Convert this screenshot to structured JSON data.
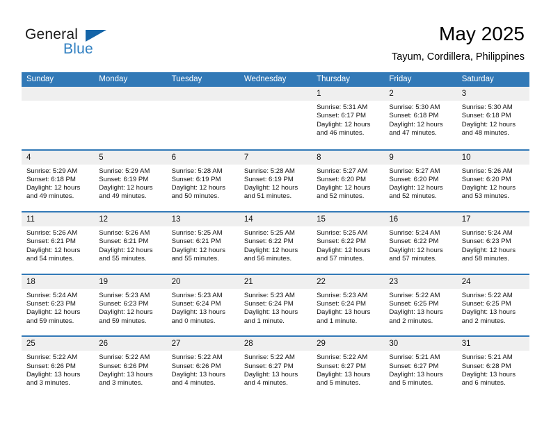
{
  "brand": {
    "name_part1": "General",
    "name_part2": "Blue",
    "flag_icon": "blue-triangle-flag-icon",
    "accent_color": "#2f7fc1"
  },
  "header": {
    "title": "May 2025",
    "location": "Tayum, Cordillera, Philippines"
  },
  "theme": {
    "header_blue": "#3279b7",
    "day_band_gray": "#efefef",
    "text_color": "#111111"
  },
  "weekdays": [
    "Sunday",
    "Monday",
    "Tuesday",
    "Wednesday",
    "Thursday",
    "Friday",
    "Saturday"
  ],
  "weeks": [
    [
      {
        "day": "",
        "lines": [
          "",
          "",
          "",
          ""
        ]
      },
      {
        "day": "",
        "lines": [
          "",
          "",
          "",
          ""
        ]
      },
      {
        "day": "",
        "lines": [
          "",
          "",
          "",
          ""
        ]
      },
      {
        "day": "",
        "lines": [
          "",
          "",
          "",
          ""
        ]
      },
      {
        "day": "1",
        "lines": [
          "Sunrise: 5:31 AM",
          "Sunset: 6:17 PM",
          "Daylight: 12 hours",
          "and 46 minutes."
        ]
      },
      {
        "day": "2",
        "lines": [
          "Sunrise: 5:30 AM",
          "Sunset: 6:18 PM",
          "Daylight: 12 hours",
          "and 47 minutes."
        ]
      },
      {
        "day": "3",
        "lines": [
          "Sunrise: 5:30 AM",
          "Sunset: 6:18 PM",
          "Daylight: 12 hours",
          "and 48 minutes."
        ]
      }
    ],
    [
      {
        "day": "4",
        "lines": [
          "Sunrise: 5:29 AM",
          "Sunset: 6:18 PM",
          "Daylight: 12 hours",
          "and 49 minutes."
        ]
      },
      {
        "day": "5",
        "lines": [
          "Sunrise: 5:29 AM",
          "Sunset: 6:19 PM",
          "Daylight: 12 hours",
          "and 49 minutes."
        ]
      },
      {
        "day": "6",
        "lines": [
          "Sunrise: 5:28 AM",
          "Sunset: 6:19 PM",
          "Daylight: 12 hours",
          "and 50 minutes."
        ]
      },
      {
        "day": "7",
        "lines": [
          "Sunrise: 5:28 AM",
          "Sunset: 6:19 PM",
          "Daylight: 12 hours",
          "and 51 minutes."
        ]
      },
      {
        "day": "8",
        "lines": [
          "Sunrise: 5:27 AM",
          "Sunset: 6:20 PM",
          "Daylight: 12 hours",
          "and 52 minutes."
        ]
      },
      {
        "day": "9",
        "lines": [
          "Sunrise: 5:27 AM",
          "Sunset: 6:20 PM",
          "Daylight: 12 hours",
          "and 52 minutes."
        ]
      },
      {
        "day": "10",
        "lines": [
          "Sunrise: 5:26 AM",
          "Sunset: 6:20 PM",
          "Daylight: 12 hours",
          "and 53 minutes."
        ]
      }
    ],
    [
      {
        "day": "11",
        "lines": [
          "Sunrise: 5:26 AM",
          "Sunset: 6:21 PM",
          "Daylight: 12 hours",
          "and 54 minutes."
        ]
      },
      {
        "day": "12",
        "lines": [
          "Sunrise: 5:26 AM",
          "Sunset: 6:21 PM",
          "Daylight: 12 hours",
          "and 55 minutes."
        ]
      },
      {
        "day": "13",
        "lines": [
          "Sunrise: 5:25 AM",
          "Sunset: 6:21 PM",
          "Daylight: 12 hours",
          "and 55 minutes."
        ]
      },
      {
        "day": "14",
        "lines": [
          "Sunrise: 5:25 AM",
          "Sunset: 6:22 PM",
          "Daylight: 12 hours",
          "and 56 minutes."
        ]
      },
      {
        "day": "15",
        "lines": [
          "Sunrise: 5:25 AM",
          "Sunset: 6:22 PM",
          "Daylight: 12 hours",
          "and 57 minutes."
        ]
      },
      {
        "day": "16",
        "lines": [
          "Sunrise: 5:24 AM",
          "Sunset: 6:22 PM",
          "Daylight: 12 hours",
          "and 57 minutes."
        ]
      },
      {
        "day": "17",
        "lines": [
          "Sunrise: 5:24 AM",
          "Sunset: 6:23 PM",
          "Daylight: 12 hours",
          "and 58 minutes."
        ]
      }
    ],
    [
      {
        "day": "18",
        "lines": [
          "Sunrise: 5:24 AM",
          "Sunset: 6:23 PM",
          "Daylight: 12 hours",
          "and 59 minutes."
        ]
      },
      {
        "day": "19",
        "lines": [
          "Sunrise: 5:23 AM",
          "Sunset: 6:23 PM",
          "Daylight: 12 hours",
          "and 59 minutes."
        ]
      },
      {
        "day": "20",
        "lines": [
          "Sunrise: 5:23 AM",
          "Sunset: 6:24 PM",
          "Daylight: 13 hours",
          "and 0 minutes."
        ]
      },
      {
        "day": "21",
        "lines": [
          "Sunrise: 5:23 AM",
          "Sunset: 6:24 PM",
          "Daylight: 13 hours",
          "and 1 minute."
        ]
      },
      {
        "day": "22",
        "lines": [
          "Sunrise: 5:23 AM",
          "Sunset: 6:24 PM",
          "Daylight: 13 hours",
          "and 1 minute."
        ]
      },
      {
        "day": "23",
        "lines": [
          "Sunrise: 5:22 AM",
          "Sunset: 6:25 PM",
          "Daylight: 13 hours",
          "and 2 minutes."
        ]
      },
      {
        "day": "24",
        "lines": [
          "Sunrise: 5:22 AM",
          "Sunset: 6:25 PM",
          "Daylight: 13 hours",
          "and 2 minutes."
        ]
      }
    ],
    [
      {
        "day": "25",
        "lines": [
          "Sunrise: 5:22 AM",
          "Sunset: 6:26 PM",
          "Daylight: 13 hours",
          "and 3 minutes."
        ]
      },
      {
        "day": "26",
        "lines": [
          "Sunrise: 5:22 AM",
          "Sunset: 6:26 PM",
          "Daylight: 13 hours",
          "and 3 minutes."
        ]
      },
      {
        "day": "27",
        "lines": [
          "Sunrise: 5:22 AM",
          "Sunset: 6:26 PM",
          "Daylight: 13 hours",
          "and 4 minutes."
        ]
      },
      {
        "day": "28",
        "lines": [
          "Sunrise: 5:22 AM",
          "Sunset: 6:27 PM",
          "Daylight: 13 hours",
          "and 4 minutes."
        ]
      },
      {
        "day": "29",
        "lines": [
          "Sunrise: 5:22 AM",
          "Sunset: 6:27 PM",
          "Daylight: 13 hours",
          "and 5 minutes."
        ]
      },
      {
        "day": "30",
        "lines": [
          "Sunrise: 5:21 AM",
          "Sunset: 6:27 PM",
          "Daylight: 13 hours",
          "and 5 minutes."
        ]
      },
      {
        "day": "31",
        "lines": [
          "Sunrise: 5:21 AM",
          "Sunset: 6:28 PM",
          "Daylight: 13 hours",
          "and 6 minutes."
        ]
      }
    ]
  ]
}
